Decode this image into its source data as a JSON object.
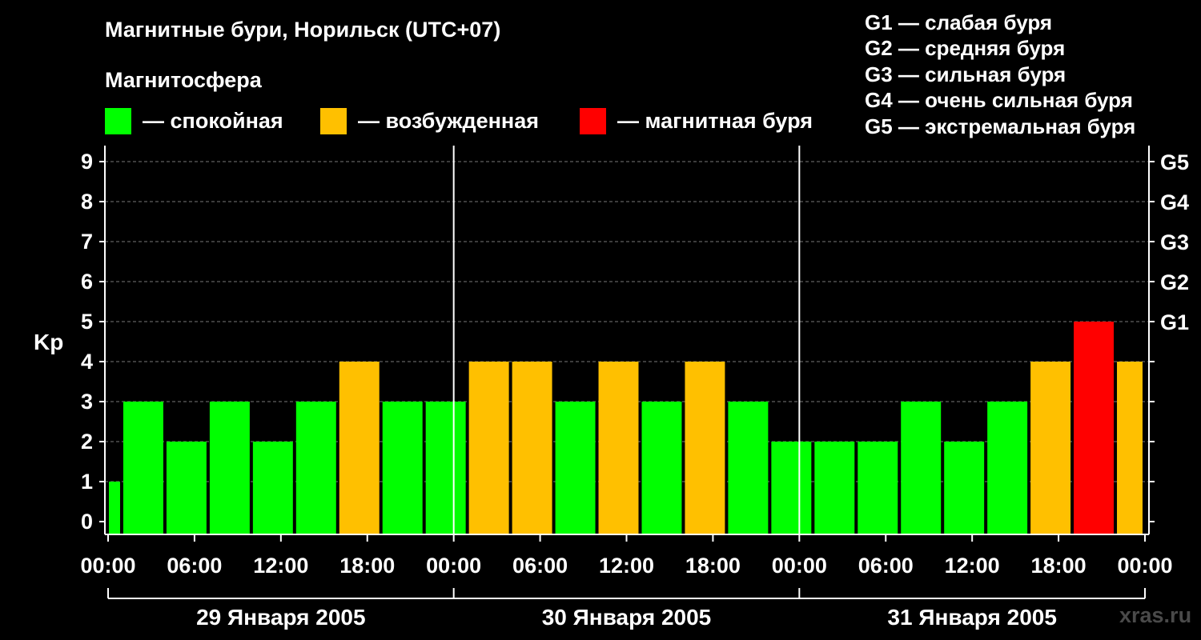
{
  "title": "Магнитные бури, Норильск (UTC+07)",
  "subtitle": "Магнитосфера",
  "legend": [
    {
      "label": "— спокойная",
      "color": "#00ff00"
    },
    {
      "label": "— возбужденная",
      "color": "#ffc000"
    },
    {
      "label": "— магнитная буря",
      "color": "#ff0000"
    }
  ],
  "g_legend": [
    "G1 — слабая буря",
    "G2 — средняя буря",
    "G3 — сильная буря",
    "G4 — очень сильная буря",
    "G5 — экстремальная буря"
  ],
  "watermark": "xras.ru",
  "chart_data": {
    "type": "bar",
    "ylabel": "Kp",
    "ylim": [
      0,
      9
    ],
    "yticks": [
      "0",
      "1",
      "2",
      "3",
      "4",
      "5",
      "6",
      "7",
      "8",
      "9"
    ],
    "right_ticks": [
      {
        "value": 5,
        "label": "G1"
      },
      {
        "value": 6,
        "label": "G2"
      },
      {
        "value": 7,
        "label": "G3"
      },
      {
        "value": 8,
        "label": "G4"
      },
      {
        "value": 9,
        "label": "G5"
      }
    ],
    "xtick_labels": [
      "00:00",
      "06:00",
      "12:00",
      "18:00",
      "00:00",
      "06:00",
      "12:00",
      "18:00",
      "00:00",
      "06:00",
      "12:00",
      "18:00",
      "00:00"
    ],
    "xlim_hours": [
      0,
      72
    ],
    "days": [
      "29 Января 2005",
      "30 Января 2005",
      "31 Января 2005"
    ],
    "grid": "dashed horizontal at integer Kp",
    "colors": {
      "calm": "#00ff00",
      "active": "#ffc000",
      "storm": "#ff0000"
    },
    "bars": [
      {
        "start_hour": 0,
        "end_hour": 1,
        "kp": 1,
        "level": "calm"
      },
      {
        "start_hour": 1,
        "end_hour": 4,
        "kp": 3,
        "level": "calm"
      },
      {
        "start_hour": 4,
        "end_hour": 7,
        "kp": 2,
        "level": "calm"
      },
      {
        "start_hour": 7,
        "end_hour": 10,
        "kp": 3,
        "level": "calm"
      },
      {
        "start_hour": 10,
        "end_hour": 13,
        "kp": 2,
        "level": "calm"
      },
      {
        "start_hour": 13,
        "end_hour": 16,
        "kp": 3,
        "level": "calm"
      },
      {
        "start_hour": 16,
        "end_hour": 19,
        "kp": 4,
        "level": "active"
      },
      {
        "start_hour": 19,
        "end_hour": 22,
        "kp": 3,
        "level": "calm"
      },
      {
        "start_hour": 22,
        "end_hour": 25,
        "kp": 3,
        "level": "calm"
      },
      {
        "start_hour": 25,
        "end_hour": 28,
        "kp": 4,
        "level": "active"
      },
      {
        "start_hour": 28,
        "end_hour": 31,
        "kp": 4,
        "level": "active"
      },
      {
        "start_hour": 31,
        "end_hour": 34,
        "kp": 3,
        "level": "calm"
      },
      {
        "start_hour": 34,
        "end_hour": 37,
        "kp": 4,
        "level": "active"
      },
      {
        "start_hour": 37,
        "end_hour": 40,
        "kp": 3,
        "level": "calm"
      },
      {
        "start_hour": 40,
        "end_hour": 43,
        "kp": 4,
        "level": "active"
      },
      {
        "start_hour": 43,
        "end_hour": 46,
        "kp": 3,
        "level": "calm"
      },
      {
        "start_hour": 46,
        "end_hour": 49,
        "kp": 2,
        "level": "calm"
      },
      {
        "start_hour": 49,
        "end_hour": 52,
        "kp": 2,
        "level": "calm"
      },
      {
        "start_hour": 52,
        "end_hour": 55,
        "kp": 2,
        "level": "calm"
      },
      {
        "start_hour": 55,
        "end_hour": 58,
        "kp": 3,
        "level": "calm"
      },
      {
        "start_hour": 58,
        "end_hour": 61,
        "kp": 2,
        "level": "calm"
      },
      {
        "start_hour": 61,
        "end_hour": 64,
        "kp": 3,
        "level": "calm"
      },
      {
        "start_hour": 64,
        "end_hour": 67,
        "kp": 4,
        "level": "active"
      },
      {
        "start_hour": 67,
        "end_hour": 70,
        "kp": 5,
        "level": "storm"
      },
      {
        "start_hour": 70,
        "end_hour": 72,
        "kp": 4,
        "level": "active"
      }
    ]
  }
}
